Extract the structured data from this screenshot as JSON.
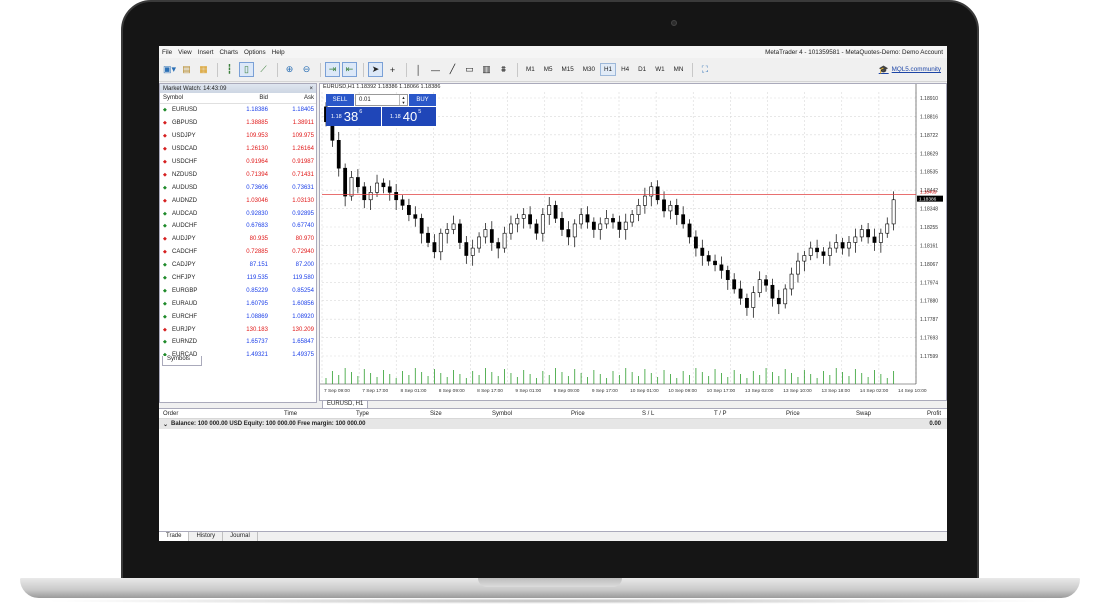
{
  "app": {
    "menu": [
      "File",
      "View",
      "Insert",
      "Charts",
      "Options",
      "Help"
    ],
    "window_title": "MetaTrader 4 - 101359581 - MetaQuotes-Demo: Demo Account"
  },
  "toolbar": {
    "timeframes": [
      "M1",
      "M5",
      "M15",
      "M30",
      "H1",
      "H4",
      "D1",
      "W1",
      "MN"
    ],
    "selected_timeframe": "H1",
    "mql_link": "MQL5.community"
  },
  "market_watch": {
    "title": "Market Watch: 14:43:09",
    "close": "×",
    "columns": [
      "Symbol",
      "Bid",
      "Ask"
    ],
    "rows": [
      {
        "symbol": "EURUSD",
        "bid": "1.18386",
        "ask": "1.18405",
        "dir": "up",
        "color": "blue"
      },
      {
        "symbol": "GBPUSD",
        "bid": "1.38885",
        "ask": "1.38911",
        "dir": "dn",
        "color": "red"
      },
      {
        "symbol": "USDJPY",
        "bid": "109.953",
        "ask": "109.975",
        "dir": "dn",
        "color": "red"
      },
      {
        "symbol": "USDCAD",
        "bid": "1.26130",
        "ask": "1.26164",
        "dir": "dn",
        "color": "red"
      },
      {
        "symbol": "USDCHF",
        "bid": "0.91964",
        "ask": "0.91987",
        "dir": "dn",
        "color": "red"
      },
      {
        "symbol": "NZDUSD",
        "bid": "0.71394",
        "ask": "0.71431",
        "dir": "dn",
        "color": "red"
      },
      {
        "symbol": "AUDUSD",
        "bid": "0.73606",
        "ask": "0.73631",
        "dir": "up",
        "color": "blue"
      },
      {
        "symbol": "AUDNZD",
        "bid": "1.03046",
        "ask": "1.03130",
        "dir": "dn",
        "color": "red"
      },
      {
        "symbol": "AUDCAD",
        "bid": "0.92830",
        "ask": "0.92895",
        "dir": "up",
        "color": "blue"
      },
      {
        "symbol": "AUDCHF",
        "bid": "0.67683",
        "ask": "0.67740",
        "dir": "up",
        "color": "blue"
      },
      {
        "symbol": "AUDJPY",
        "bid": "80.935",
        "ask": "80.970",
        "dir": "dn",
        "color": "red"
      },
      {
        "symbol": "CADCHF",
        "bid": "0.72885",
        "ask": "0.72940",
        "dir": "dn",
        "color": "red"
      },
      {
        "symbol": "CADJPY",
        "bid": "87.151",
        "ask": "87.200",
        "dir": "up",
        "color": "blue"
      },
      {
        "symbol": "CHFJPY",
        "bid": "119.535",
        "ask": "119.580",
        "dir": "up",
        "color": "blue"
      },
      {
        "symbol": "EURGBP",
        "bid": "0.85229",
        "ask": "0.85254",
        "dir": "up",
        "color": "blue"
      },
      {
        "symbol": "EURAUD",
        "bid": "1.60795",
        "ask": "1.60856",
        "dir": "up",
        "color": "blue"
      },
      {
        "symbol": "EURCHF",
        "bid": "1.08869",
        "ask": "1.08920",
        "dir": "up",
        "color": "blue"
      },
      {
        "symbol": "EURJPY",
        "bid": "130.183",
        "ask": "130.209",
        "dir": "dn",
        "color": "red"
      },
      {
        "symbol": "EURNZD",
        "bid": "1.65737",
        "ask": "1.65847",
        "dir": "up",
        "color": "blue"
      },
      {
        "symbol": "EURCAD",
        "bid": "1.49321",
        "ask": "1.49375",
        "dir": "up",
        "color": "blue"
      }
    ],
    "tab": "Symbols"
  },
  "chart": {
    "header": "EURUSD,H1  1.18392 1.18386 1.18066 1.18386",
    "tab": "EURUSD, H1",
    "one_click": {
      "sell_label": "SELL",
      "buy_label": "BUY",
      "lot": "0.01",
      "sell_big": "1.18",
      "sell_pips": "38",
      "sell_sup": "6",
      "buy_big": "1.18",
      "buy_pips": "40",
      "buy_sup": "5"
    },
    "price_labels": [
      "1.18910",
      "1.18816",
      "1.18722",
      "1.18629",
      "1.18535",
      "1.18442",
      "1.18348",
      "1.18255",
      "1.18161",
      "1.18067",
      "1.17974",
      "1.17880",
      "1.17787",
      "1.17693",
      "1.17599"
    ],
    "current_price_label": "1.18386",
    "hline_label": "1.18409",
    "time_labels": [
      "7 Sep 09:00",
      "7 Sep 17:00",
      "8 Sep 01:00",
      "8 Sep 09:00",
      "8 Sep 17:00",
      "9 Sep 01:00",
      "9 Sep 09:00",
      "9 Sep 17:00",
      "10 Sep 01:00",
      "10 Sep 09:00",
      "10 Sep 17:00",
      "13 Sep 02:00",
      "13 Sep 10:00",
      "13 Sep 18:00",
      "14 Sep 02:00",
      "14 Sep 10:00"
    ],
    "colors": {
      "grid": "#d9d9d9",
      "candle": "#000000",
      "volume": "#2e9e2e",
      "hline": "#e04040"
    }
  },
  "chart_data": {
    "type": "candlestick",
    "close": [
      1.188,
      1.187,
      1.1855,
      1.184,
      1.185,
      1.1845,
      1.1838,
      1.1842,
      1.1847,
      1.1845,
      1.1842,
      1.1838,
      1.1835,
      1.183,
      1.1828,
      1.182,
      1.1815,
      1.181,
      1.182,
      1.1822,
      1.1825,
      1.1815,
      1.1808,
      1.1812,
      1.1818,
      1.1822,
      1.1815,
      1.1812,
      1.182,
      1.1825,
      1.1828,
      1.183,
      1.1825,
      1.182,
      1.183,
      1.1835,
      1.1828,
      1.1822,
      1.1818,
      1.1825,
      1.183,
      1.1826,
      1.1822,
      1.1825,
      1.1828,
      1.1826,
      1.1822,
      1.1826,
      1.183,
      1.1835,
      1.184,
      1.1845,
      1.1838,
      1.1832,
      1.1835,
      1.183,
      1.1825,
      1.1818,
      1.1812,
      1.1808,
      1.1805,
      1.1803,
      1.18,
      1.1795,
      1.179,
      1.1785,
      1.178,
      1.1788,
      1.1795,
      1.1792,
      1.1785,
      1.1782,
      1.179,
      1.1798,
      1.1805,
      1.1808,
      1.1812,
      1.181,
      1.1808,
      1.1812,
      1.1815,
      1.1812,
      1.1815,
      1.1818,
      1.1822,
      1.1818,
      1.1815,
      1.182,
      1.1825,
      1.1838
    ],
    "price_range": [
      1.1755,
      1.1896
    ],
    "hline": 1.18409,
    "current": 1.18386
  },
  "terminal": {
    "columns": [
      "Order",
      "Time",
      "Type",
      "Size",
      "Symbol",
      "Price",
      "S / L",
      "T / P",
      "Price",
      "Swap",
      "Profit"
    ],
    "balance_text": "Balance: 100 000.00 USD  Equity: 100 000.00  Free margin: 100 000.00",
    "profit": "0.00",
    "tabs": [
      "Trade",
      "History",
      "Journal"
    ]
  }
}
